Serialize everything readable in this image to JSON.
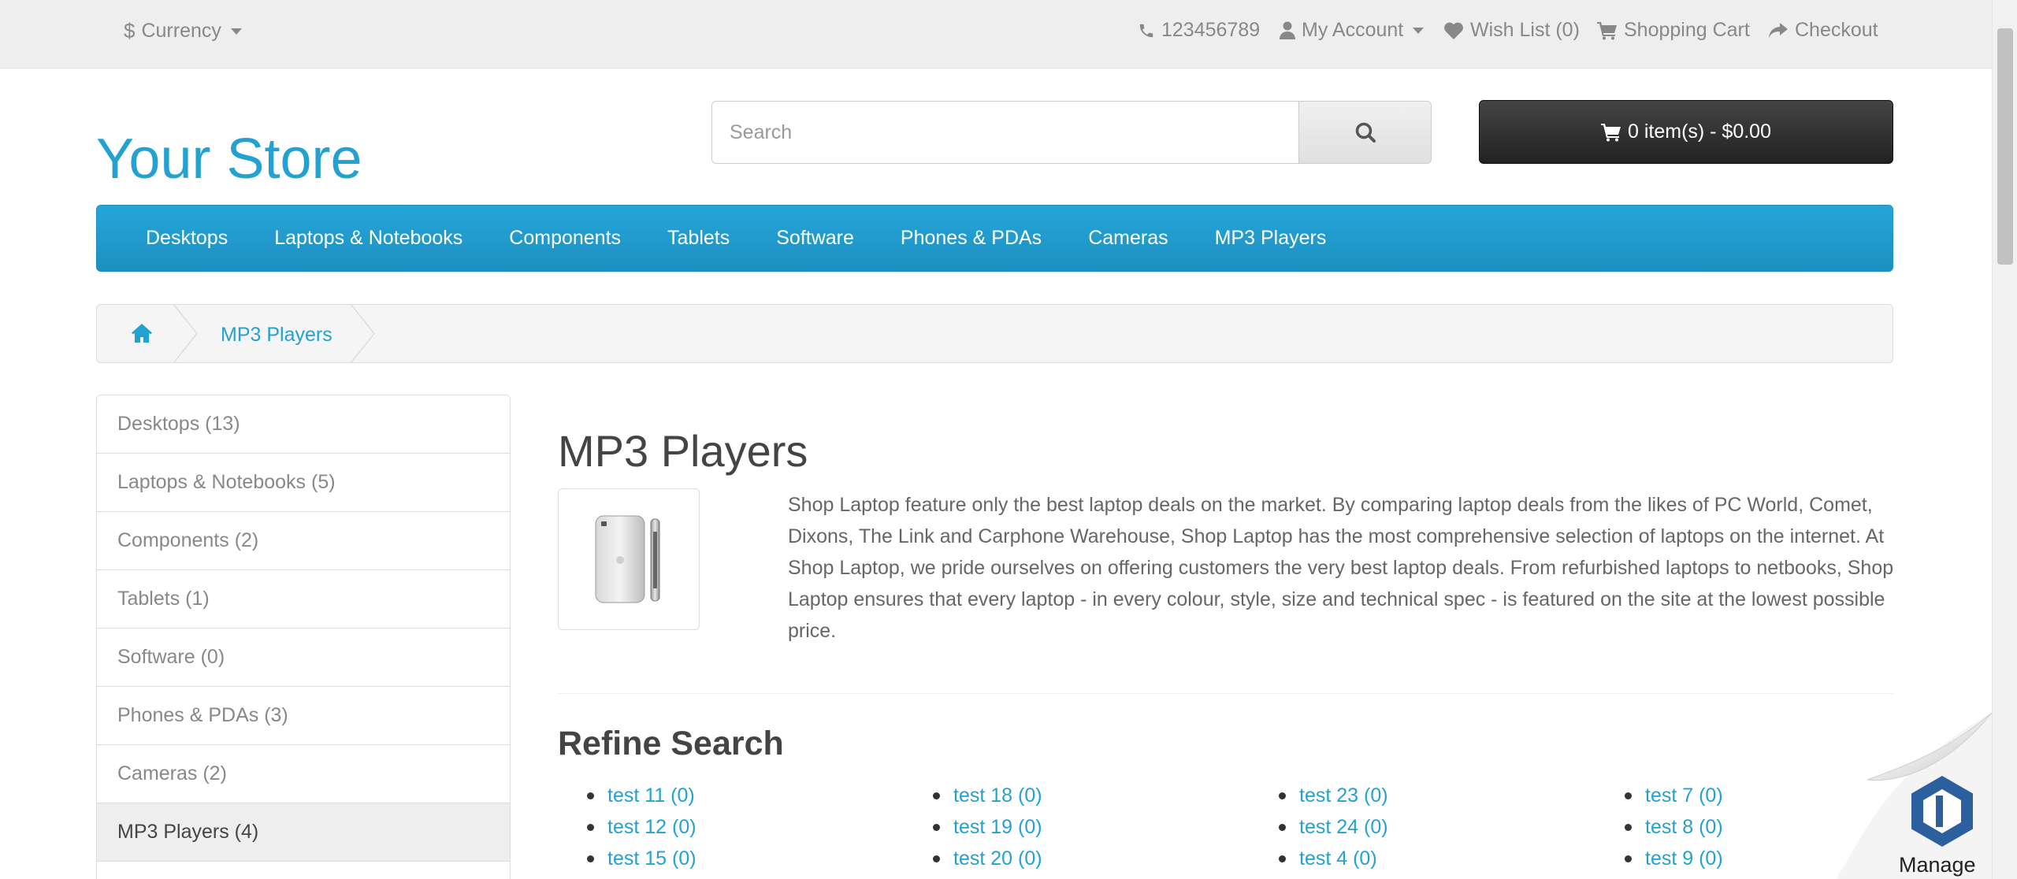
{
  "topbar": {
    "currency_label": "Currency",
    "currency_symbol": "$",
    "phone": "123456789",
    "my_account": "My Account",
    "wish_list": "Wish List (0)",
    "shopping_cart": "Shopping Cart",
    "checkout": "Checkout"
  },
  "header": {
    "logo": "Your Store",
    "search_placeholder": "Search",
    "cart_button": "0 item(s) - $0.00"
  },
  "nav": {
    "items": [
      "Desktops",
      "Laptops & Notebooks",
      "Components",
      "Tablets",
      "Software",
      "Phones & PDAs",
      "Cameras",
      "MP3 Players"
    ]
  },
  "breadcrumb": {
    "current": "MP3 Players"
  },
  "sidebar": {
    "categories": [
      "Desktops (13)",
      "Laptops & Notebooks (5)",
      "Components (2)",
      "Tablets (1)",
      "Software (0)",
      "Phones & PDAs (3)",
      "Cameras (2)",
      "MP3 Players (4)"
    ],
    "active_index": 7
  },
  "main": {
    "title": "MP3 Players",
    "description": "Shop Laptop feature only the best laptop deals on the market. By comparing laptop deals from the likes of PC World, Comet, Dixons, The Link and Carphone Warehouse, Shop Laptop has the most comprehensive selection of laptops on the internet. At Shop Laptop, we pride ourselves on offering customers the very best laptop deals. From refurbished laptops to netbooks, Shop Laptop ensures that every laptop - in every colour, style, size and technical spec - is featured on the site at the lowest possible price.",
    "refine_title": "Refine Search",
    "refine_columns": [
      [
        "test 11 (0)",
        "test 12 (0)",
        "test 15 (0)"
      ],
      [
        "test 18 (0)",
        "test 19 (0)",
        "test 20 (0)"
      ],
      [
        "test 23 (0)",
        "test 24 (0)",
        "test 4 (0)"
      ],
      [
        "test 7 (0)",
        "test 8 (0)",
        "test 9 (0)"
      ]
    ]
  },
  "badge": {
    "label": "Manage"
  },
  "colors": {
    "accent": "#23a1d1",
    "nav_bg": "#229ac8",
    "cart_bg": "#363636",
    "topbar_bg": "#eeeeee"
  },
  "icons": {
    "currency": "dollar-icon",
    "phone": "phone-icon",
    "account": "user-icon",
    "wishlist": "heart-icon",
    "cart": "cart-icon",
    "checkout": "share-icon",
    "search": "search-icon",
    "home": "home-icon"
  }
}
